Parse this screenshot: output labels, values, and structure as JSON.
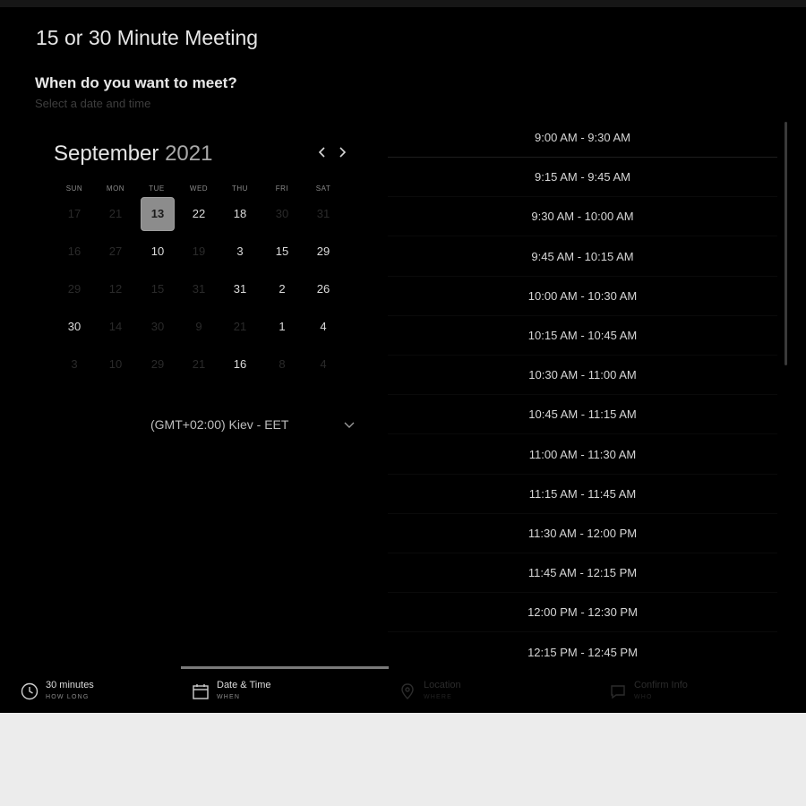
{
  "meeting": {
    "title": "15 or 30 Minute Meeting",
    "question": "When do you want to meet?",
    "hint": "Select a date and time"
  },
  "calendar": {
    "month": "September",
    "year": "2021",
    "prev_icon": "chevron-left-icon",
    "next_icon": "chevron-right-icon",
    "weekdays": [
      "SUN",
      "MON",
      "TUE",
      "WED",
      "THU",
      "FRI",
      "SAT"
    ],
    "rows": [
      [
        "17",
        "21",
        "13",
        "22",
        "18",
        "30",
        "31"
      ],
      [
        "16",
        "27",
        "10",
        "19",
        "3",
        "15",
        "29"
      ],
      [
        "29",
        "12",
        "15",
        "31",
        "31",
        "2",
        "26"
      ],
      [
        "30",
        "14",
        "30",
        "9",
        "21",
        "1",
        "4"
      ],
      [
        "3",
        "10",
        "29",
        "21",
        "16",
        "8",
        "4"
      ]
    ],
    "selected": "13"
  },
  "timezone": {
    "label": "(GMT+02:00) Kiev - EET",
    "icon": "chevron-down-icon"
  },
  "slots": [
    "9:00 AM - 9:30 AM",
    "9:15 AM - 9:45 AM",
    "9:30 AM - 10:00 AM",
    "9:45 AM - 10:15 AM",
    "10:00 AM - 10:30 AM",
    "10:15 AM - 10:45 AM",
    "10:30 AM - 11:00 AM",
    "10:45 AM - 11:15 AM",
    "11:00 AM - 11:30 AM",
    "11:15 AM - 11:45 AM",
    "11:30 AM - 12:00 PM",
    "11:45 AM - 12:15 PM",
    "12:00 PM - 12:30 PM",
    "12:15 PM - 12:45 PM"
  ],
  "steps": [
    {
      "title": "30 minutes",
      "subtitle": "HOW LONG",
      "icon": "clock-icon"
    },
    {
      "title": "Date & Time",
      "subtitle": "WHEN",
      "icon": "calendar-icon"
    },
    {
      "title": "Location",
      "subtitle": "WHERE",
      "icon": "location-pin-icon"
    },
    {
      "title": "Confirm Info",
      "subtitle": "WHO",
      "icon": "chat-bubble-icon"
    }
  ],
  "colors": {
    "background": "#000000",
    "selected_day": "#8c8c8c",
    "text": "#e6e6e6",
    "muted_text": "#2a2a2a"
  }
}
